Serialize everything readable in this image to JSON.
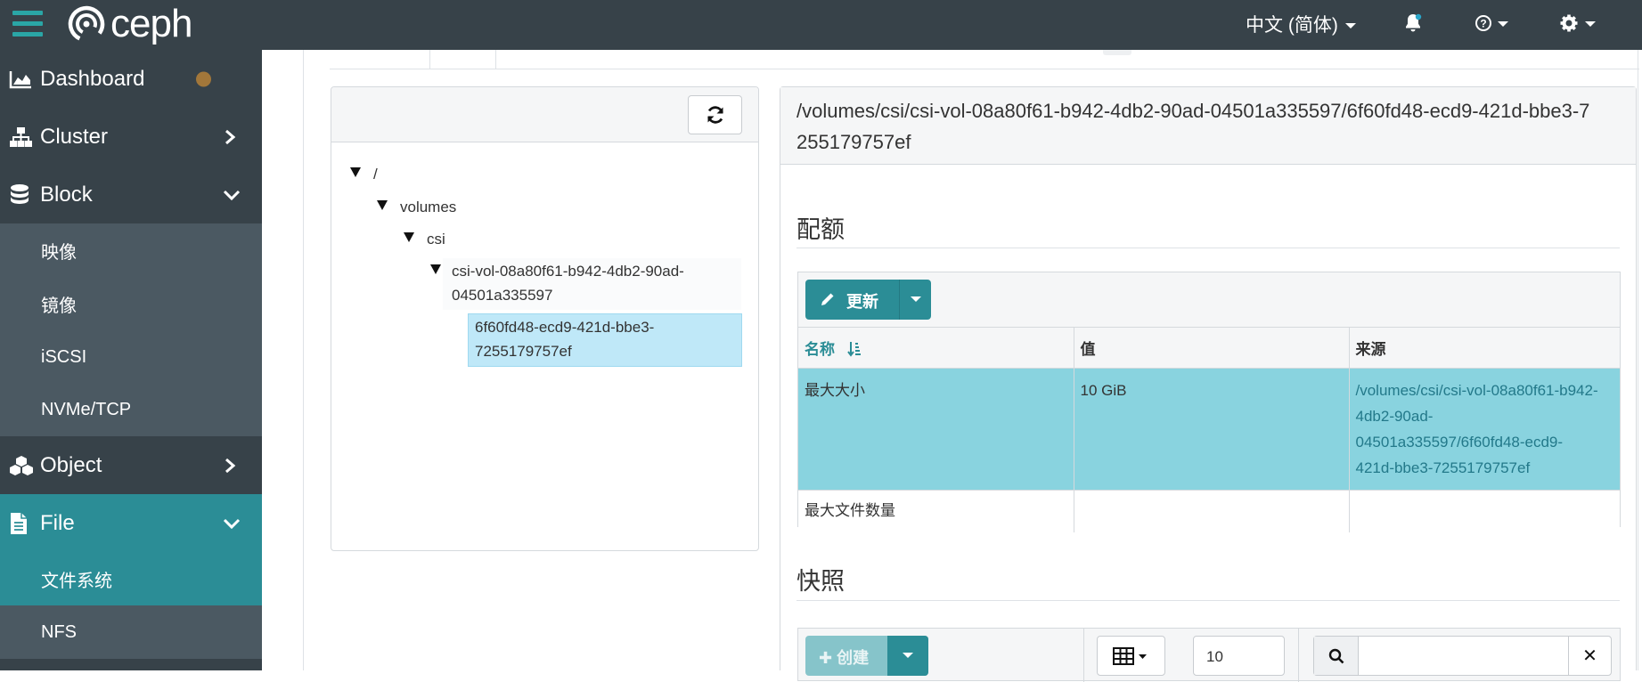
{
  "header": {
    "logo_text": "ceph",
    "language": "中文 (简体)"
  },
  "icons": {
    "menu": "hamburger-icon",
    "bell": "bell-icon",
    "help": "help-icon",
    "settings": "gear-icon",
    "refresh": "refresh-icon",
    "edit": "pencil-icon",
    "sort": "sort-icon",
    "columns": "table-columns-icon",
    "search": "search-icon",
    "clear": "close-icon"
  },
  "colors": {
    "topbar": "#374249",
    "accent": "#2b8d96",
    "selected_row": "#89d3df",
    "selected_tree_node": "#bfe8f8",
    "status_dot": "#a2773a"
  },
  "sidebar": {
    "dashboard": "Dashboard",
    "cluster": "Cluster",
    "block": "Block",
    "block_items": [
      "映像",
      "镜像",
      "iSCSI",
      "NVMe/TCP"
    ],
    "object": "Object",
    "file": "File",
    "file_items": [
      "文件系统",
      "NFS"
    ]
  },
  "tree": {
    "root": "/",
    "volumes": "volumes",
    "csi": "csi",
    "csi_vol_line1": "csi-vol-08a80f61-b942-4db2-90ad-",
    "csi_vol_line2": "04501a335597",
    "selected_line1": "6f60fd48-ecd9-421d-bbe3-",
    "selected_line2": "7255179757ef"
  },
  "details": {
    "path": "/volumes/csi/csi-vol-08a80f61-b942-4db2-90ad-04501a335597/6f60fd48-ecd9-421d-bbe3-7255179757ef",
    "quota_title": "配额",
    "update_label": "更新",
    "columns": [
      "名称",
      "值",
      "来源"
    ],
    "rows": [
      {
        "name": "最大大小",
        "value": "10 GiB",
        "source_lines": [
          "/volumes/csi/csi-vol-08a80f61-b942-",
          "4db2-90ad-",
          "04501a335597/6f60fd48-ecd9-",
          "421d-bbe3-7255179757ef"
        ]
      },
      {
        "name": "最大文件数量",
        "value": "",
        "source_lines": [
          ""
        ]
      }
    ],
    "snapshot_title": "快照",
    "create_label": "创建",
    "page_size": "10"
  }
}
